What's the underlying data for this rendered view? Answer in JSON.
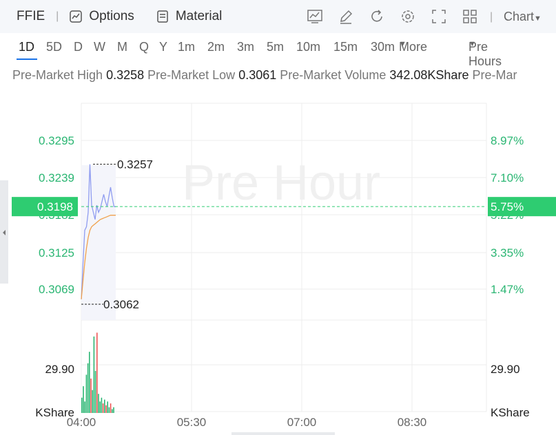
{
  "header": {
    "symbol": "FFIE",
    "options_label": "Options",
    "material_label": "Material",
    "chart_label": "Chart",
    "icons": [
      "indicator-icon",
      "draw-icon",
      "refresh-icon",
      "settings-icon",
      "fullscreen-icon",
      "layout-icon"
    ]
  },
  "periods": [
    "1D",
    "5D",
    "D",
    "W",
    "M",
    "Q",
    "Y",
    "1m",
    "2m",
    "3m",
    "5m",
    "10m",
    "15m",
    "30m"
  ],
  "more_label": "More",
  "session_label": "Pre Hours",
  "stats": {
    "high_label": "Pre-Market High",
    "high_value": "0.3258",
    "low_label": "Pre-Market Low",
    "low_value": "0.3061",
    "volume_label": "Pre-Market Volume",
    "volume_value": "342.08KShare",
    "trailing_label": "Pre-Mar"
  },
  "watermark": "Pre Hour",
  "chart_data": {
    "type": "line",
    "x_ticks": [
      "04:00",
      "05:30",
      "07:00",
      "08:30"
    ],
    "price_ticks": [
      "0.3295",
      "0.3239",
      "0.3182",
      "0.3125",
      "0.3069"
    ],
    "percent_ticks": [
      "8.97%",
      "7.10%",
      "5.22%",
      "3.35%",
      "1.47%"
    ],
    "current_price": "0.3198",
    "current_percent": "5.75%",
    "high_annotation": "0.3257",
    "low_annotation": "0.3062",
    "volume_tick": "29.90",
    "volume_unit": "KShare",
    "ylim": [
      0.304,
      0.334
    ],
    "series": [
      {
        "color": "#8f9cf0",
        "x": [
          0,
          0.05,
          0.1,
          0.15,
          0.2,
          0.25,
          0.3,
          0.35,
          0.4,
          0.45,
          0.5,
          0.55,
          0.6,
          0.65,
          0.7,
          0.75,
          0.8,
          0.85,
          0.9,
          0.95,
          1.0
        ],
        "y": [
          0.3069,
          0.312,
          0.3165,
          0.317,
          0.319,
          0.3257,
          0.32,
          0.319,
          0.318,
          0.32,
          0.319,
          0.3195,
          0.3205,
          0.3215,
          0.3205,
          0.3198,
          0.3212,
          0.3225,
          0.321,
          0.3198,
          0.3198
        ]
      },
      {
        "color": "#f0a04b",
        "x": [
          0,
          0.05,
          0.1,
          0.15,
          0.2,
          0.25,
          0.3,
          0.35,
          0.4,
          0.45,
          0.5,
          0.55,
          0.6,
          0.65,
          0.7,
          0.75,
          0.8,
          0.85,
          0.9,
          0.95,
          1.0
        ],
        "y": [
          0.3069,
          0.3095,
          0.312,
          0.314,
          0.3155,
          0.3165,
          0.317,
          0.3172,
          0.3174,
          0.3176,
          0.3178,
          0.318,
          0.3181,
          0.3182,
          0.3183,
          0.3184,
          0.3185,
          0.3186,
          0.3186,
          0.3186,
          0.3186
        ]
      }
    ],
    "volume_ylim": [
      0,
      45
    ],
    "volume": [
      {
        "v": 8,
        "c": "#2bb673"
      },
      {
        "v": 14,
        "c": "#2bb673"
      },
      {
        "v": 6,
        "c": "#2bb673"
      },
      {
        "v": 20,
        "c": "#2bb673"
      },
      {
        "v": 26,
        "c": "#2bb673"
      },
      {
        "v": 32,
        "c": "#2bb673"
      },
      {
        "v": 18,
        "c": "#f05555"
      },
      {
        "v": 12,
        "c": "#2bb673"
      },
      {
        "v": 40,
        "c": "#2bb673"
      },
      {
        "v": 22,
        "c": "#2bb673"
      },
      {
        "v": 42,
        "c": "#f05555"
      },
      {
        "v": 10,
        "c": "#2bb673"
      },
      {
        "v": 6,
        "c": "#2bb673"
      },
      {
        "v": 8,
        "c": "#2bb673"
      },
      {
        "v": 5,
        "c": "#f05555"
      },
      {
        "v": 7,
        "c": "#2bb673"
      },
      {
        "v": 4,
        "c": "#f05555"
      },
      {
        "v": 6,
        "c": "#2bb673"
      },
      {
        "v": 3,
        "c": "#2bb673"
      },
      {
        "v": 5,
        "c": "#f05555"
      },
      {
        "v": 2,
        "c": "#2bb673"
      },
      {
        "v": 3,
        "c": "#2bb673"
      }
    ],
    "colors": {
      "up": "#2bb673",
      "current": "#2ecc71",
      "grid": "#ececec"
    }
  }
}
